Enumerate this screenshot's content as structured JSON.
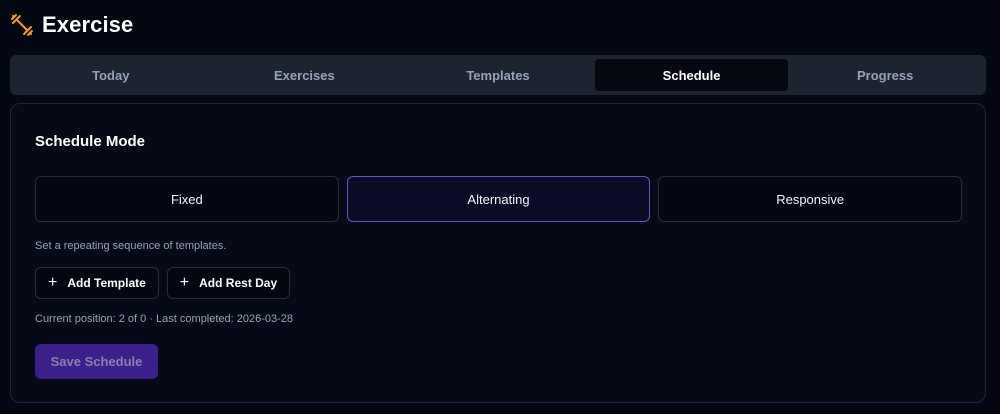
{
  "app": {
    "title": "Exercise",
    "icon": "dumbbell-icon",
    "accent_color": "#f59e0b"
  },
  "tabs": [
    {
      "label": "Today",
      "active": false
    },
    {
      "label": "Exercises",
      "active": false
    },
    {
      "label": "Templates",
      "active": false
    },
    {
      "label": "Schedule",
      "active": true
    },
    {
      "label": "Progress",
      "active": false
    }
  ],
  "schedule": {
    "heading": "Schedule Mode",
    "modes": [
      {
        "label": "Fixed",
        "selected": false
      },
      {
        "label": "Alternating",
        "selected": true
      },
      {
        "label": "Responsive",
        "selected": false
      }
    ],
    "description": "Set a repeating sequence of templates.",
    "add_template_label": "Add Template",
    "add_rest_day_label": "Add Rest Day",
    "status_text": "Current position: 2 of 0 · Last completed: 2026-03-28",
    "save_label": "Save Schedule",
    "selected_border_color": "#6d4bd8",
    "save_button_color": "#3b1f8a"
  }
}
